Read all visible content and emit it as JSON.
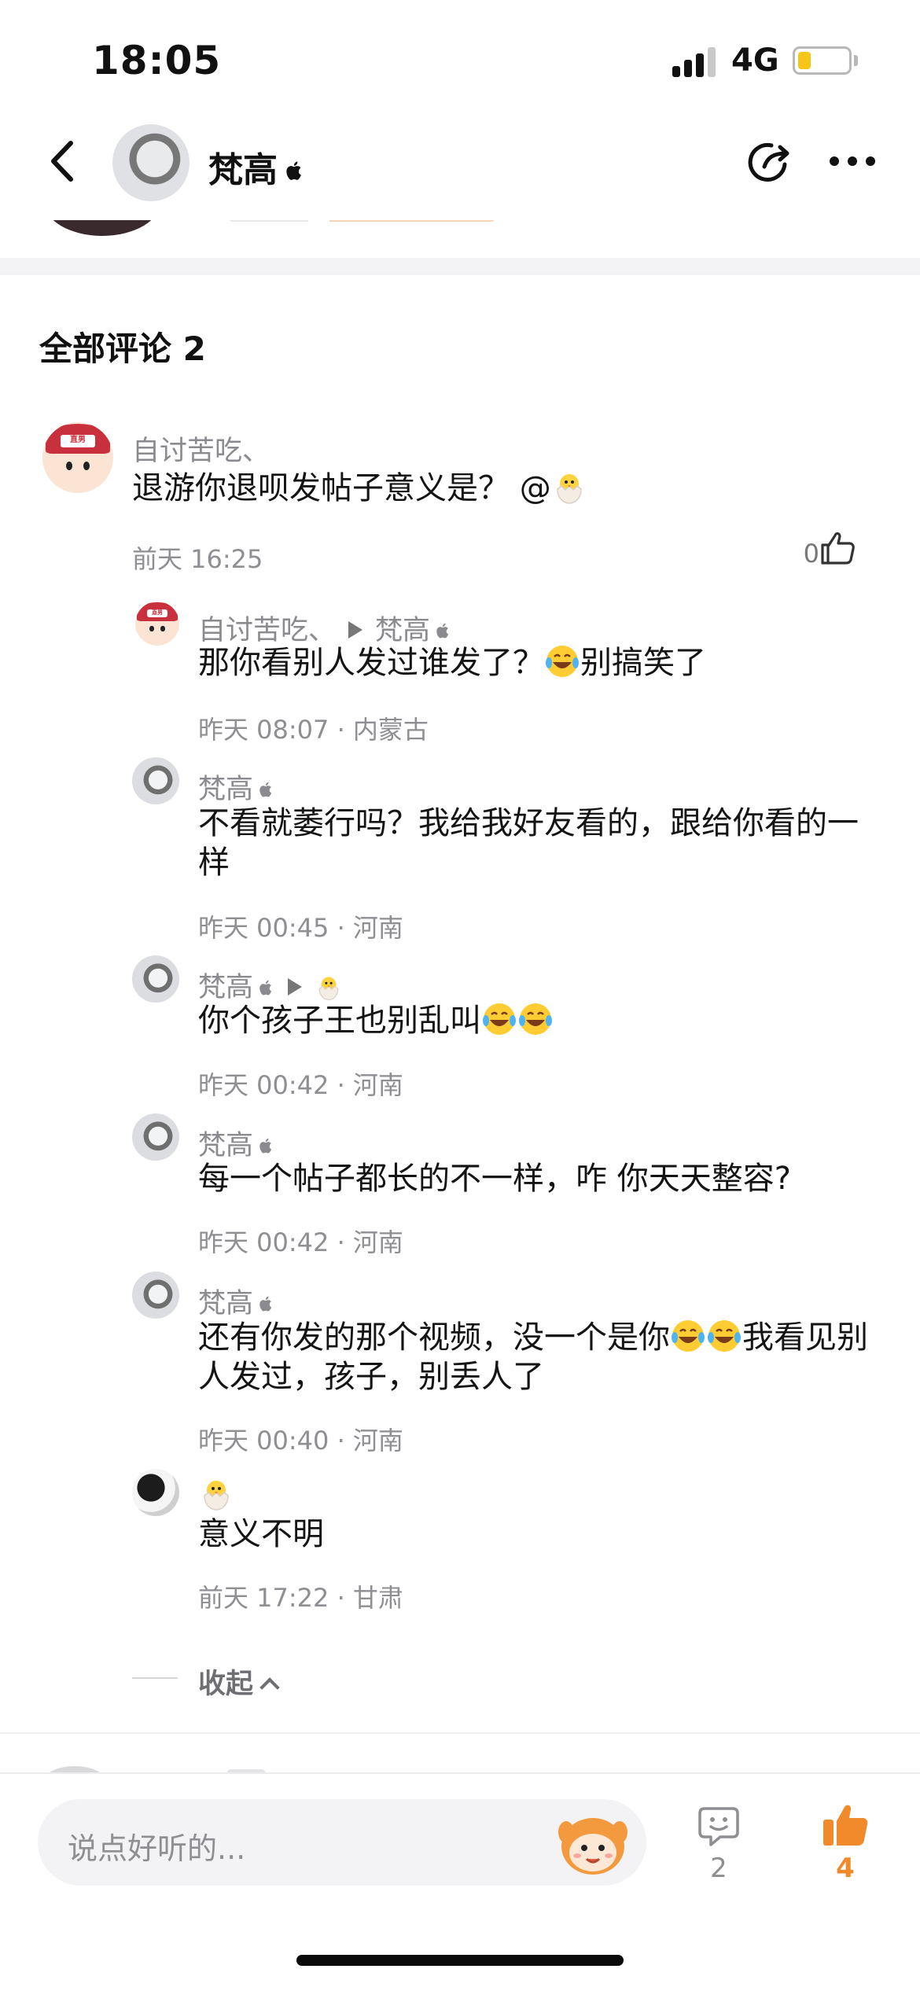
{
  "status_bar": {
    "time": "18:05",
    "network": "4G",
    "battery_level": 0.25,
    "battery_color": "#f5c518"
  },
  "header": {
    "name": "梵高",
    "back_icon": "chevron-left-icon",
    "share_icon": "share-arrow-icon",
    "more_icon": "more-dots-icon"
  },
  "comments": {
    "section_title": "全部评论 2",
    "top": {
      "username": "自讨苦吃、",
      "text": "退游你退呗发帖子意义是？ @",
      "time": "前天 16:25",
      "likes": "0"
    },
    "replies": [
      {
        "username": "自讨苦吃、",
        "reply_to": "梵高",
        "text": "那你看别人发过谁发了？",
        "text_tail": "别搞笑了",
        "meta": "昨天 08:07 · 内蒙古"
      },
      {
        "username": "梵高",
        "text": "不看就萎行吗？我给我好友看的，跟给你看的一样",
        "meta": "昨天 00:45 · 河南"
      },
      {
        "username": "梵高",
        "text": "你个孩子王也别乱叫",
        "meta": "昨天 00:42 · 河南"
      },
      {
        "username": "梵高",
        "text": "每一个帖子都长的不一样，咋 你天天整容?",
        "meta": "昨天 00:42 · 河南"
      },
      {
        "username": "梵高",
        "text": "还有你发的那个视频，没一个是你",
        "text_tail": "我看见别人发过，孩子，别丢人了",
        "meta": "昨天 00:40 · 河南"
      },
      {
        "username": "",
        "text": "意义不明",
        "meta": "前天 17:22 · 甘肃"
      }
    ],
    "collapse_label": "收起"
  },
  "bottom_bar": {
    "input_placeholder": "说点好听的...",
    "comment_count": "2",
    "like_count": "4",
    "accent_color": "#f08a2a"
  }
}
